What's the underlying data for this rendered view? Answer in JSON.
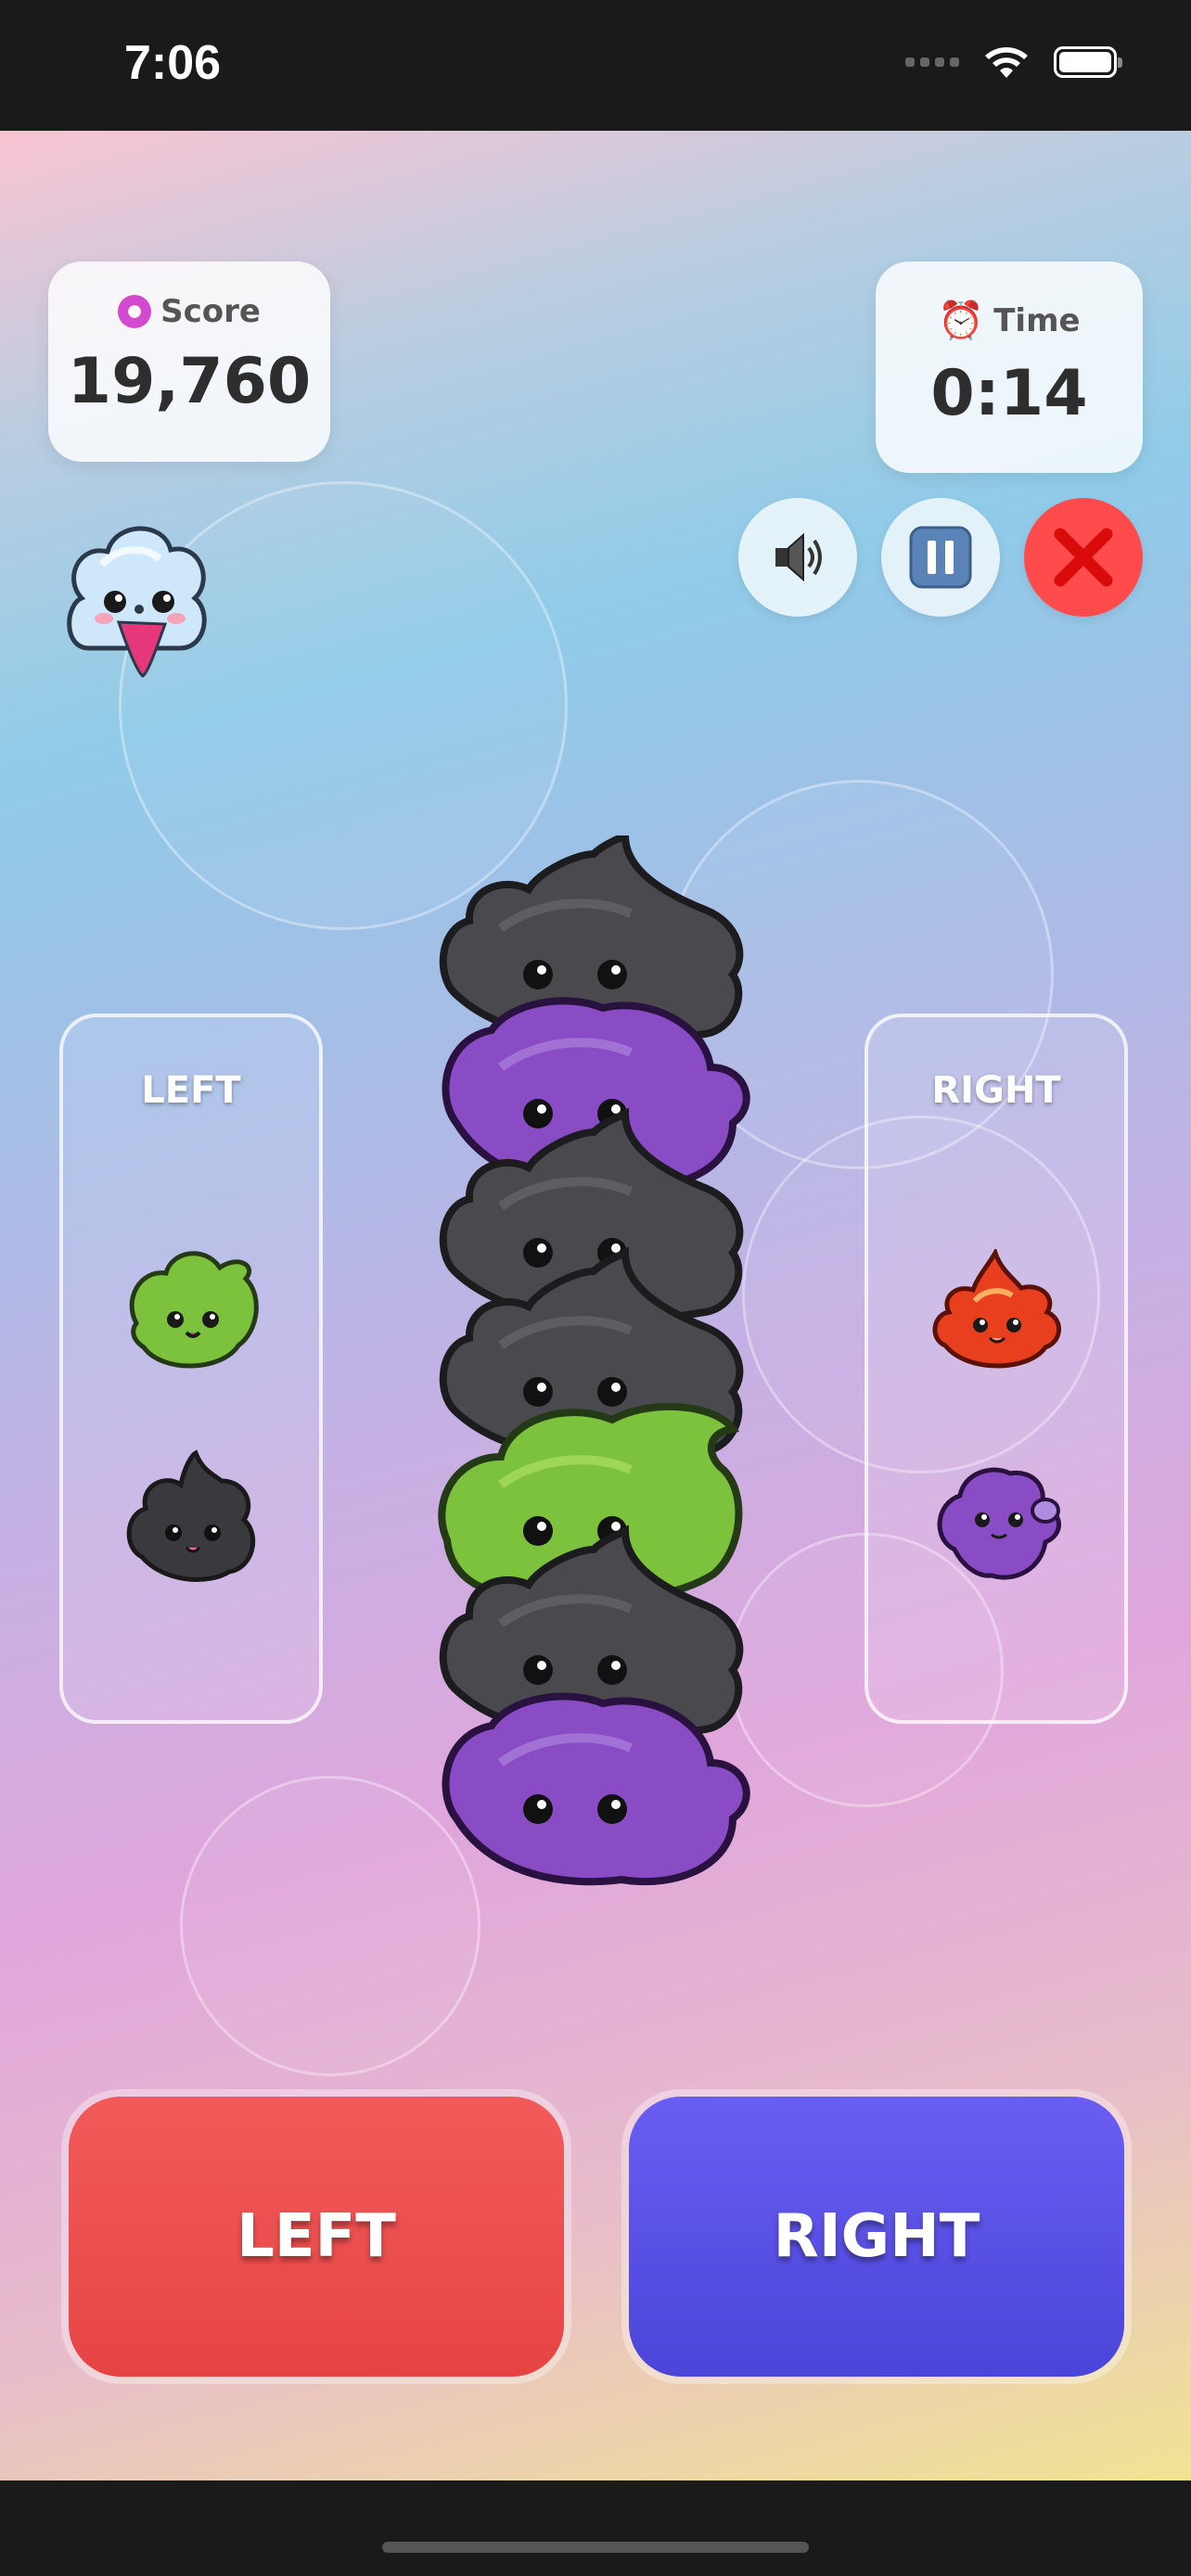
{
  "status_bar": {
    "time": "7:06"
  },
  "hud": {
    "score": {
      "label": "Score",
      "value": "19,760",
      "icon": "donut-icon"
    },
    "time": {
      "label": "Time",
      "value": "0:14",
      "icon": "alarm-clock-icon"
    },
    "controls": [
      "speaker-icon",
      "pause-icon",
      "close-icon"
    ]
  },
  "mascot": "cotton-candy-cloud-character",
  "left_panel": {
    "title": "LEFT",
    "creatures": [
      "green-leaf-creature",
      "black-blob-creature"
    ]
  },
  "right_panel": {
    "title": "RIGHT",
    "creatures": [
      "red-fire-creature",
      "purple-blob-creature"
    ]
  },
  "stack": [
    "black",
    "purple",
    "black",
    "black",
    "green",
    "black",
    "purple"
  ],
  "buttons": {
    "left": "LEFT",
    "right": "RIGHT"
  },
  "colors": {
    "left_button": "#ec4d4d",
    "right_button": "#5450e6",
    "close_button": "#ff4b4b",
    "black_creature": "#4a4a4e",
    "purple_creature": "#8a4cc4",
    "green_creature": "#7cc23c",
    "red_creature": "#e8401f"
  }
}
